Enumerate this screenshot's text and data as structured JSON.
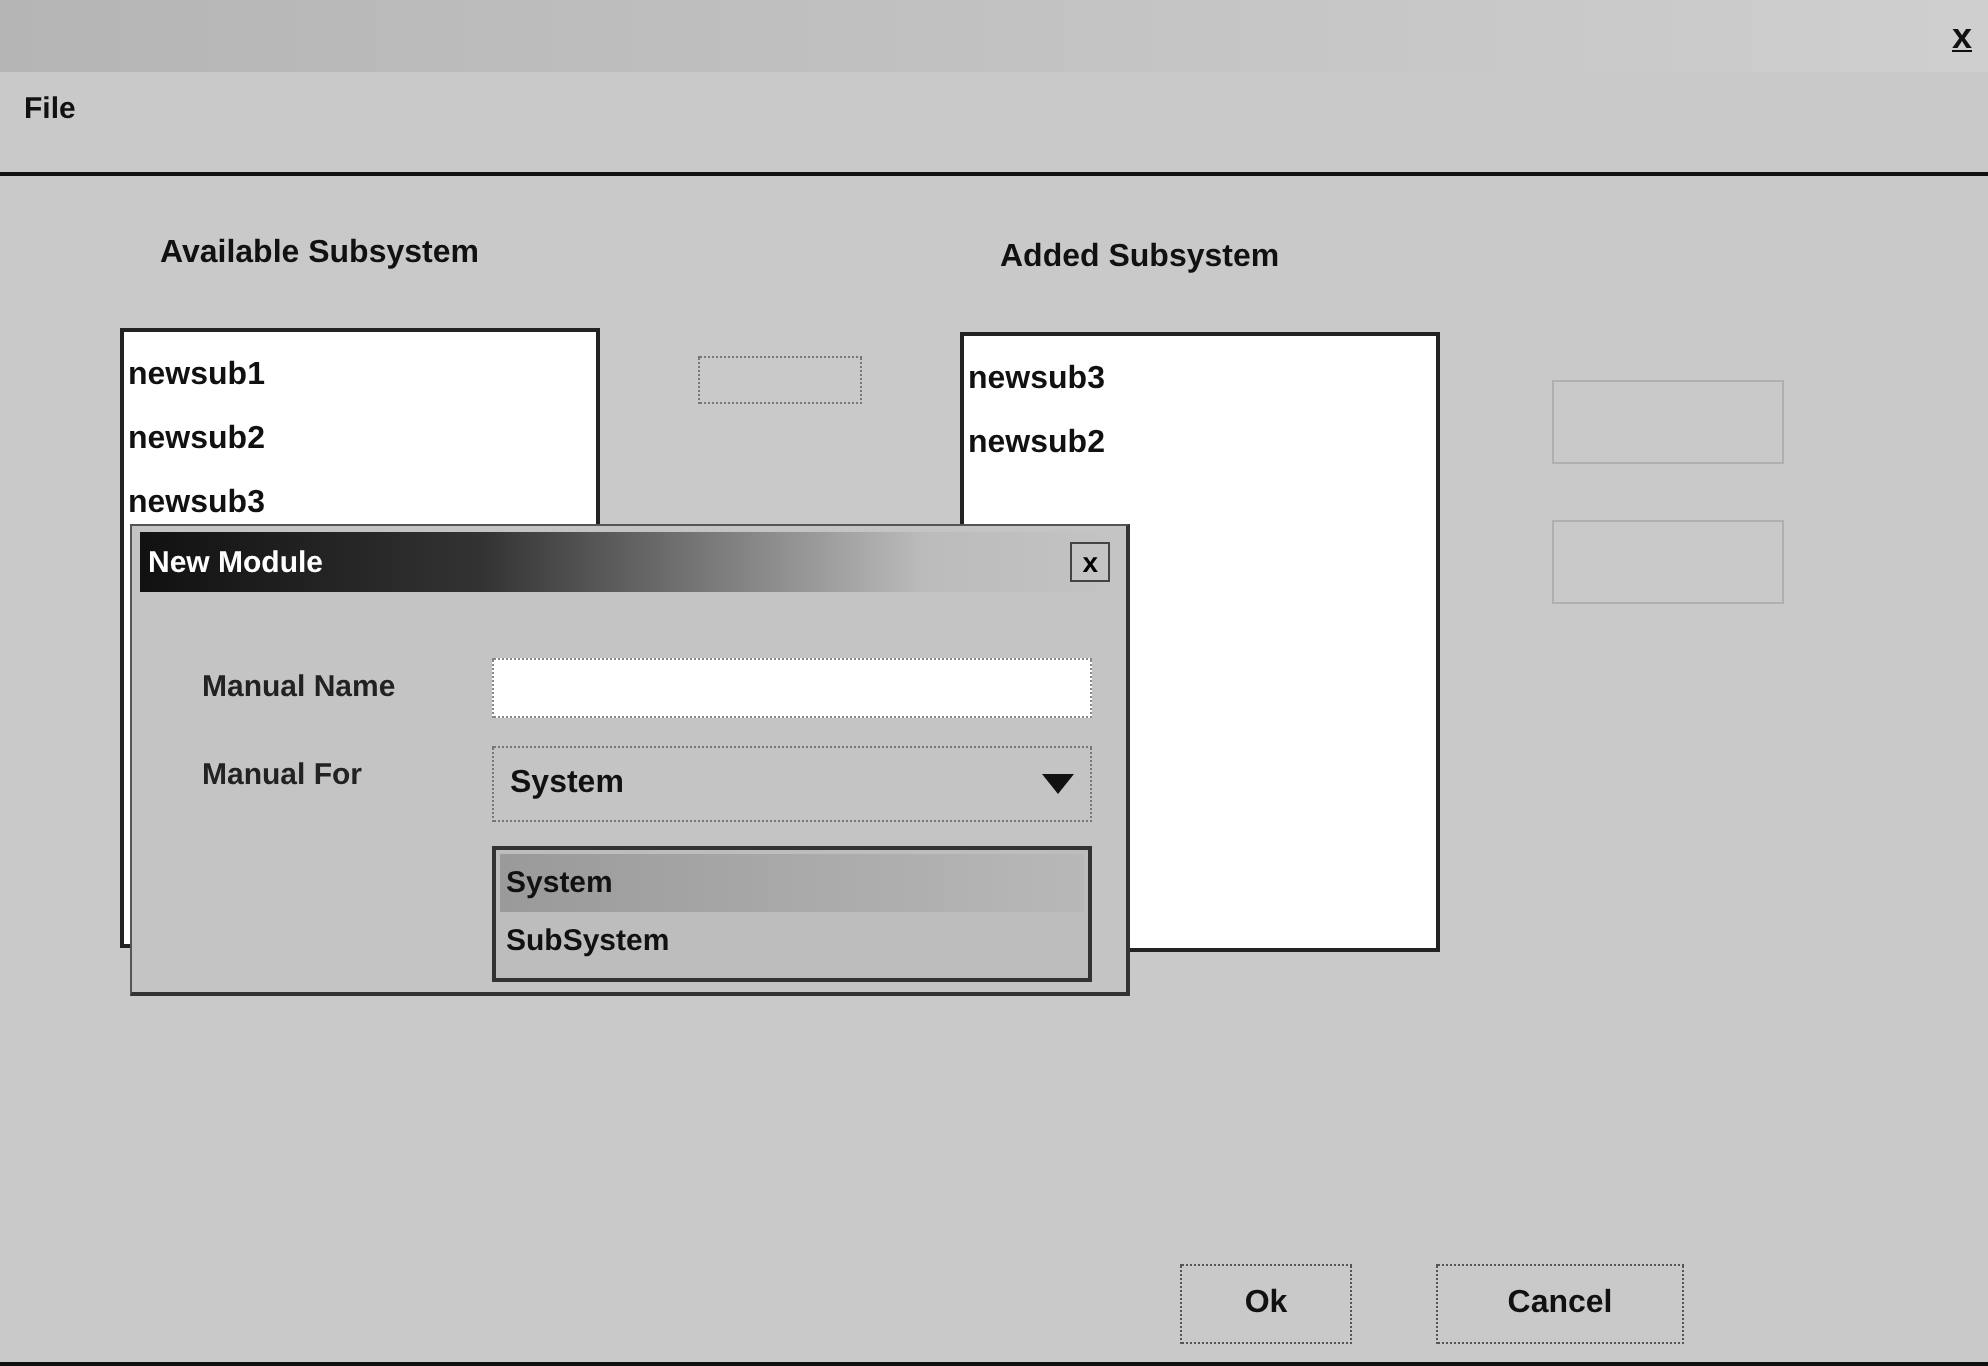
{
  "window": {
    "close_label": "x"
  },
  "menu": [
    {
      "label": "File"
    }
  ],
  "available": {
    "title": "Available Subsystem",
    "items": [
      "newsub1",
      "newsub2",
      "newsub3"
    ]
  },
  "transfer_button": {
    "disabled": false
  },
  "added": {
    "title": "Added Subsystem",
    "items": [
      "newsub3",
      "newsub2"
    ]
  },
  "side_buttons": [
    {
      "disabled": true
    },
    {
      "disabled": true
    }
  ],
  "dialog": {
    "title": "New Module",
    "close_label": "x",
    "fields": [
      {
        "kind": "text",
        "label": "Manual Name"
      },
      {
        "kind": "combo",
        "label": "Manual For",
        "value": "System",
        "expanded": true,
        "options": [
          {
            "label": "System",
            "selected": true
          },
          {
            "label": "SubSystem",
            "selected": false
          }
        ]
      }
    ]
  },
  "buttons": [
    {
      "label": "Ok"
    },
    {
      "label": "Cancel"
    }
  ]
}
